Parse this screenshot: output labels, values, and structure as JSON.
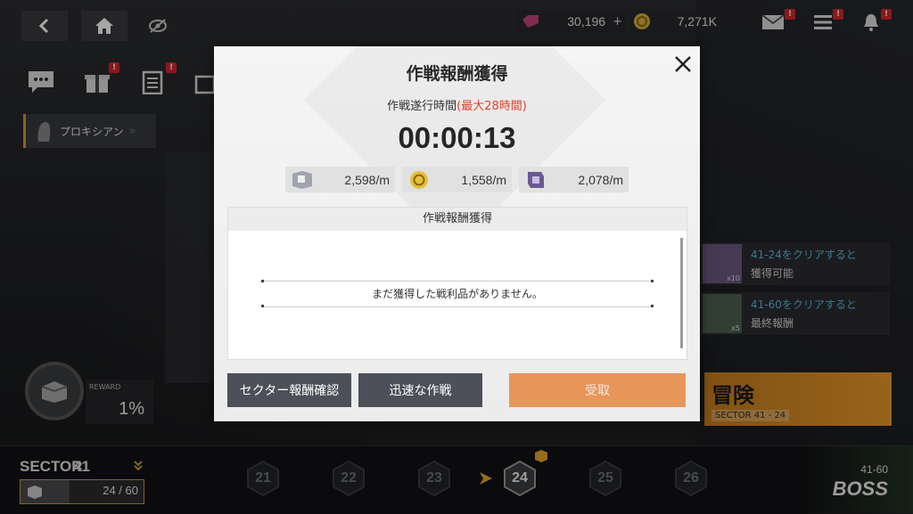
{
  "topbar": {
    "back_label": "back",
    "home_label": "home",
    "gem_value": "30,196",
    "plus_label": "+",
    "coin_value": "7,271K",
    "badge_mark": "!"
  },
  "sidebar": {
    "character_label": "プロキシアン",
    "reward_label": "REWARD",
    "reward_value": "1%"
  },
  "right_rewards": [
    {
      "title": "41-24をクリアすると",
      "desc": "獲得可能",
      "count": "x10"
    },
    {
      "title": "41-60をクリアすると",
      "desc": "最終報酬",
      "count": "x5"
    }
  ],
  "adventure": {
    "label": "冒険",
    "sector": "SECTOR 41 - 24"
  },
  "bottom": {
    "sector_label": "SECTOR",
    "sector_num": "41",
    "progress_text": "24 / 60",
    "progress_fraction": 0.4,
    "nodes": [
      "21",
      "22",
      "23",
      "24",
      "25",
      "26"
    ],
    "current_node": "24",
    "boss_level": "41-60",
    "boss_label": "BOSS"
  },
  "modal": {
    "title": "作戦報酬獲得",
    "duration_label": "作戦遂行時間",
    "duration_max": "(最大28時間)",
    "timer": "00:00:13",
    "rates": [
      {
        "icon": "book-icon",
        "value": "2,598/m"
      },
      {
        "icon": "coin-icon",
        "value": "1,558/m"
      },
      {
        "icon": "core-icon",
        "value": "2,078/m"
      }
    ],
    "panel_title": "作戦報酬獲得",
    "empty_text": "まだ獲得した戦利品がありません。",
    "buttons": {
      "sector_reward": "セクター報酬確認",
      "quick_battle": "迅速な作戦",
      "receive": "受取"
    }
  },
  "colors": {
    "accent_orange": "#e8955a",
    "highlight_red": "#e0412c",
    "link_blue": "#58b9dd",
    "badge_red": "#d5252b"
  }
}
